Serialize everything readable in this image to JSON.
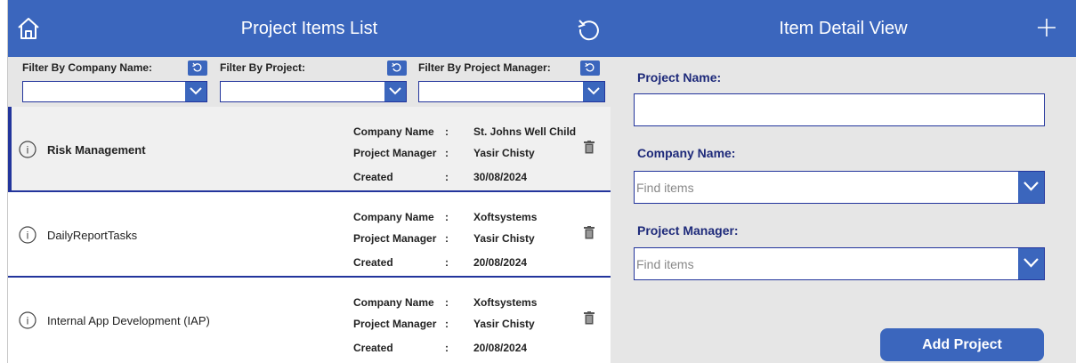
{
  "list_panel": {
    "title": "Project Items List",
    "filters": [
      {
        "label": "Filter By Company Name:",
        "value": ""
      },
      {
        "label": "Filter By Project:",
        "value": ""
      },
      {
        "label": "Filter By Project Manager:",
        "value": ""
      }
    ],
    "items": [
      {
        "title": "Risk Management",
        "company_key": "Company Name",
        "company": "St. Johns Well Child",
        "manager_key": "Project Manager",
        "manager": "Yasir Chisty",
        "created_key": "Created",
        "created": "30/08/2024"
      },
      {
        "title": "DailyReportTasks",
        "company_key": "Company Name",
        "company": "Xoftsystems",
        "manager_key": "Project Manager",
        "manager": "Yasir Chisty",
        "created_key": "Created",
        "created": "20/08/2024"
      },
      {
        "title": "Internal App Development (IAP)",
        "company_key": "Company Name",
        "company": "Xoftsystems",
        "manager_key": "Project Manager",
        "manager": "Yasir Chisty",
        "created_key": "Created",
        "created": "20/08/2024"
      }
    ],
    "colon": ":"
  },
  "detail_panel": {
    "title": "Item Detail View",
    "project_name_label": "Project Name:",
    "project_name_value": "",
    "company_label": "Company Name:",
    "company_placeholder": "Find items",
    "manager_label": "Project Manager:",
    "manager_placeholder": "Find items",
    "add_label": "Add Project"
  },
  "colors": {
    "accent": "#3b66bd",
    "border": "#23359c",
    "label": "#1e2a7a"
  },
  "icons": {
    "home": "home-icon",
    "reset": "reset-icon",
    "add": "plus-icon",
    "info": "info-icon",
    "delete": "trash-icon",
    "dropdown": "chevron-down-icon"
  }
}
